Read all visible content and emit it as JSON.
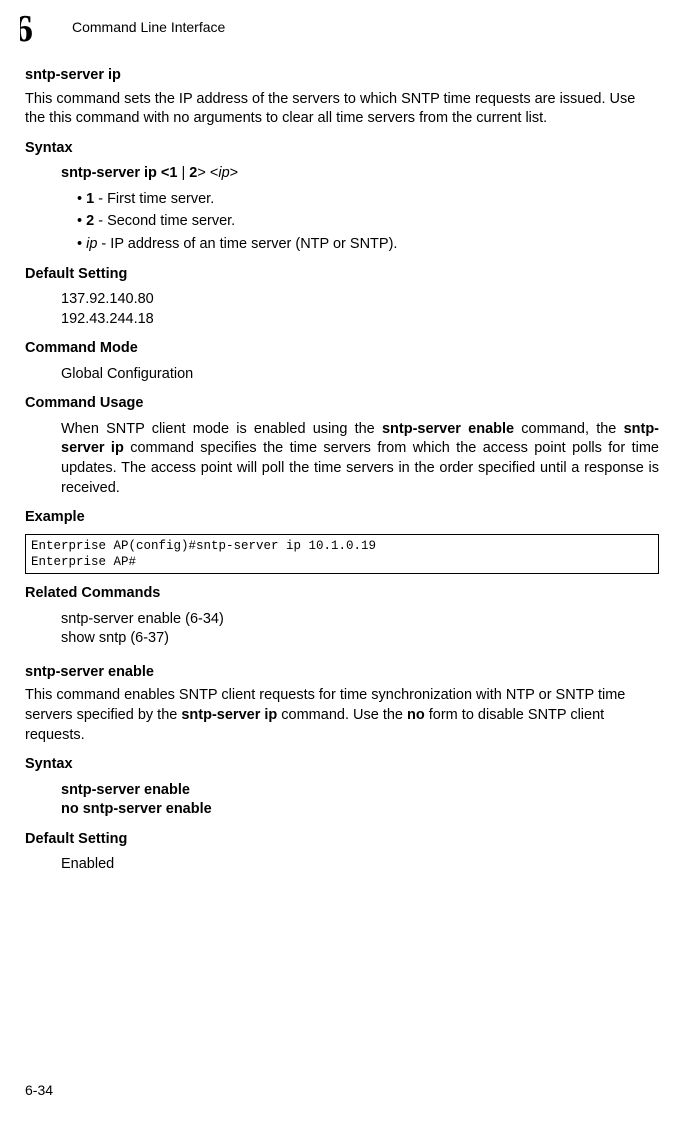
{
  "header": {
    "chapter_number": "6",
    "chapter_title": "Command Line Interface"
  },
  "cmd1": {
    "name": "sntp-server ip",
    "desc": "This command sets the IP address of the servers to which SNTP time requests are issued. Use the this command with no arguments to clear all time servers from the current list.",
    "syntax_h": "Syntax",
    "syntax_cmd_prefix": "sntp-server ip <",
    "syntax_opt1": "1",
    "syntax_pipe": " | ",
    "syntax_opt2": "2",
    "syntax_mid": "> <",
    "syntax_ip": "ip",
    "syntax_end": ">",
    "bullet1_b": "1",
    "bullet1_t": " - First time server.",
    "bullet2_b": "2",
    "bullet2_t": " - Second time server.",
    "bullet3_i": "ip",
    "bullet3_t": " - IP address of an time server (NTP or SNTP).",
    "default_h": "Default Setting",
    "default_v1": "137.92.140.80",
    "default_v2": "192.43.244.18",
    "mode_h": "Command Mode",
    "mode_v": "Global Configuration",
    "usage_h": "Command Usage",
    "usage_p1": "When SNTP client mode is enabled using the ",
    "usage_b1": "sntp-server enable",
    "usage_p2": " command, the ",
    "usage_b2": "sntp-server ip",
    "usage_p3": " command specifies the time servers from which the access point polls for time updates. The access point will poll the time servers in the order specified until a response is received.",
    "example_h": "Example",
    "example_code": "Enterprise AP(config)#sntp-server ip 10.1.0.19\nEnterprise AP#",
    "related_h": "Related Commands",
    "related1": "sntp-server enable (6-34)",
    "related2": "show sntp (6-37)"
  },
  "cmd2": {
    "name": "sntp-server enable",
    "desc_p1": "This command enables SNTP client requests for time synchronization with NTP or SNTP time servers specified by the ",
    "desc_b1": "sntp-server ip",
    "desc_p2": " command. Use the ",
    "desc_b2": "no",
    "desc_p3": " form to disable SNTP client requests.",
    "syntax_h": "Syntax",
    "syntax_l1": "sntp-server enable",
    "syntax_l2": "no sntp-server enable",
    "default_h": "Default Setting",
    "default_v": "Enabled"
  },
  "page_num": "6-34"
}
